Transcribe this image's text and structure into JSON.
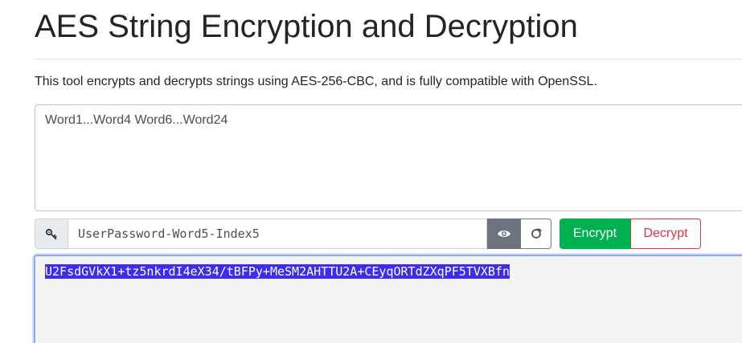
{
  "header": {
    "title": "AES String Encryption and Decryption",
    "description": "This tool encrypts and decrypts strings using AES-256-CBC, and is fully compatible with OpenSSL."
  },
  "input": {
    "value": "Word1...Word4 Word6...Word24"
  },
  "key": {
    "icon": "key-icon",
    "value": "UserPassword-Word5-Index5",
    "show_icon": "eye-icon",
    "regenerate_icon": "refresh-icon"
  },
  "actions": {
    "encrypt_label": "Encrypt",
    "decrypt_label": "Decrypt"
  },
  "output": {
    "value": "U2FsdGVkX1+tz5nkrdI4eX34/tBFPy+MeSM2AHTTU2A+CEyqORTdZXqPF5TVXBfn",
    "selected": true
  },
  "colors": {
    "encrypt": "#00b14f",
    "decrypt": "#dc3545",
    "eye_button": "#6c757d",
    "selection": "#3d2cf0",
    "focus_border": "#8fa6f0"
  }
}
